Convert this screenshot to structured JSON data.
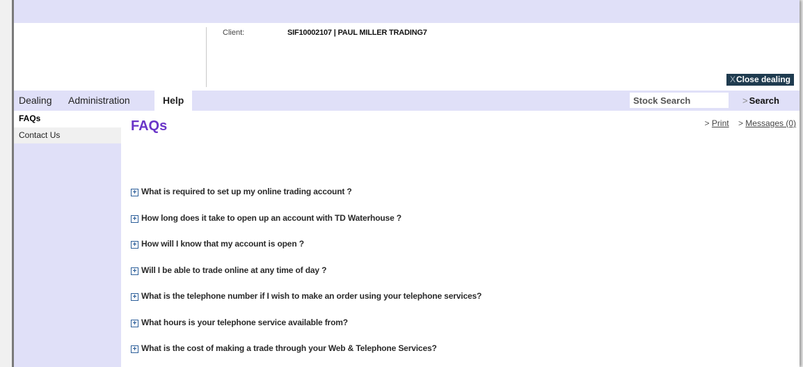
{
  "header": {
    "client_label": "Client:",
    "client_value": "SIF10002107 | PAUL MILLER TRADING7",
    "close_x": "X",
    "close_label": "Close dealing"
  },
  "nav": {
    "tabs": [
      {
        "label": "Dealing"
      },
      {
        "label": "Administration"
      },
      {
        "label": "Help",
        "active": true
      }
    ],
    "search_placeholder": "Stock Search",
    "search_arrow": ">",
    "search_label": "Search"
  },
  "sidebar": {
    "items": [
      {
        "label": "FAQs",
        "active": true
      },
      {
        "label": "Contact Us"
      }
    ]
  },
  "main": {
    "title": "FAQs",
    "links": {
      "print_prefix": ">",
      "print": "Print",
      "messages_prefix": ">",
      "messages": "Messages (0)"
    },
    "faqs": [
      "What is required to set up my online trading account ?",
      "How long does it take to open up an account with TD Waterhouse ?",
      "How will I know that my account is open ?",
      "Will I be able to trade online at any time of day ?",
      "What is the telephone number if I wish to make an order using your telephone services?",
      "What hours is your telephone service available from?",
      "What is the cost of making a trade through your Web & Telephone Services?"
    ]
  },
  "icons": {
    "expand": "plus-box-icon"
  },
  "colors": {
    "band": "#e0e0f8",
    "title": "#6a35c8",
    "close_button": "#1f3b4f",
    "expand_icon": "#2d5f9a"
  }
}
